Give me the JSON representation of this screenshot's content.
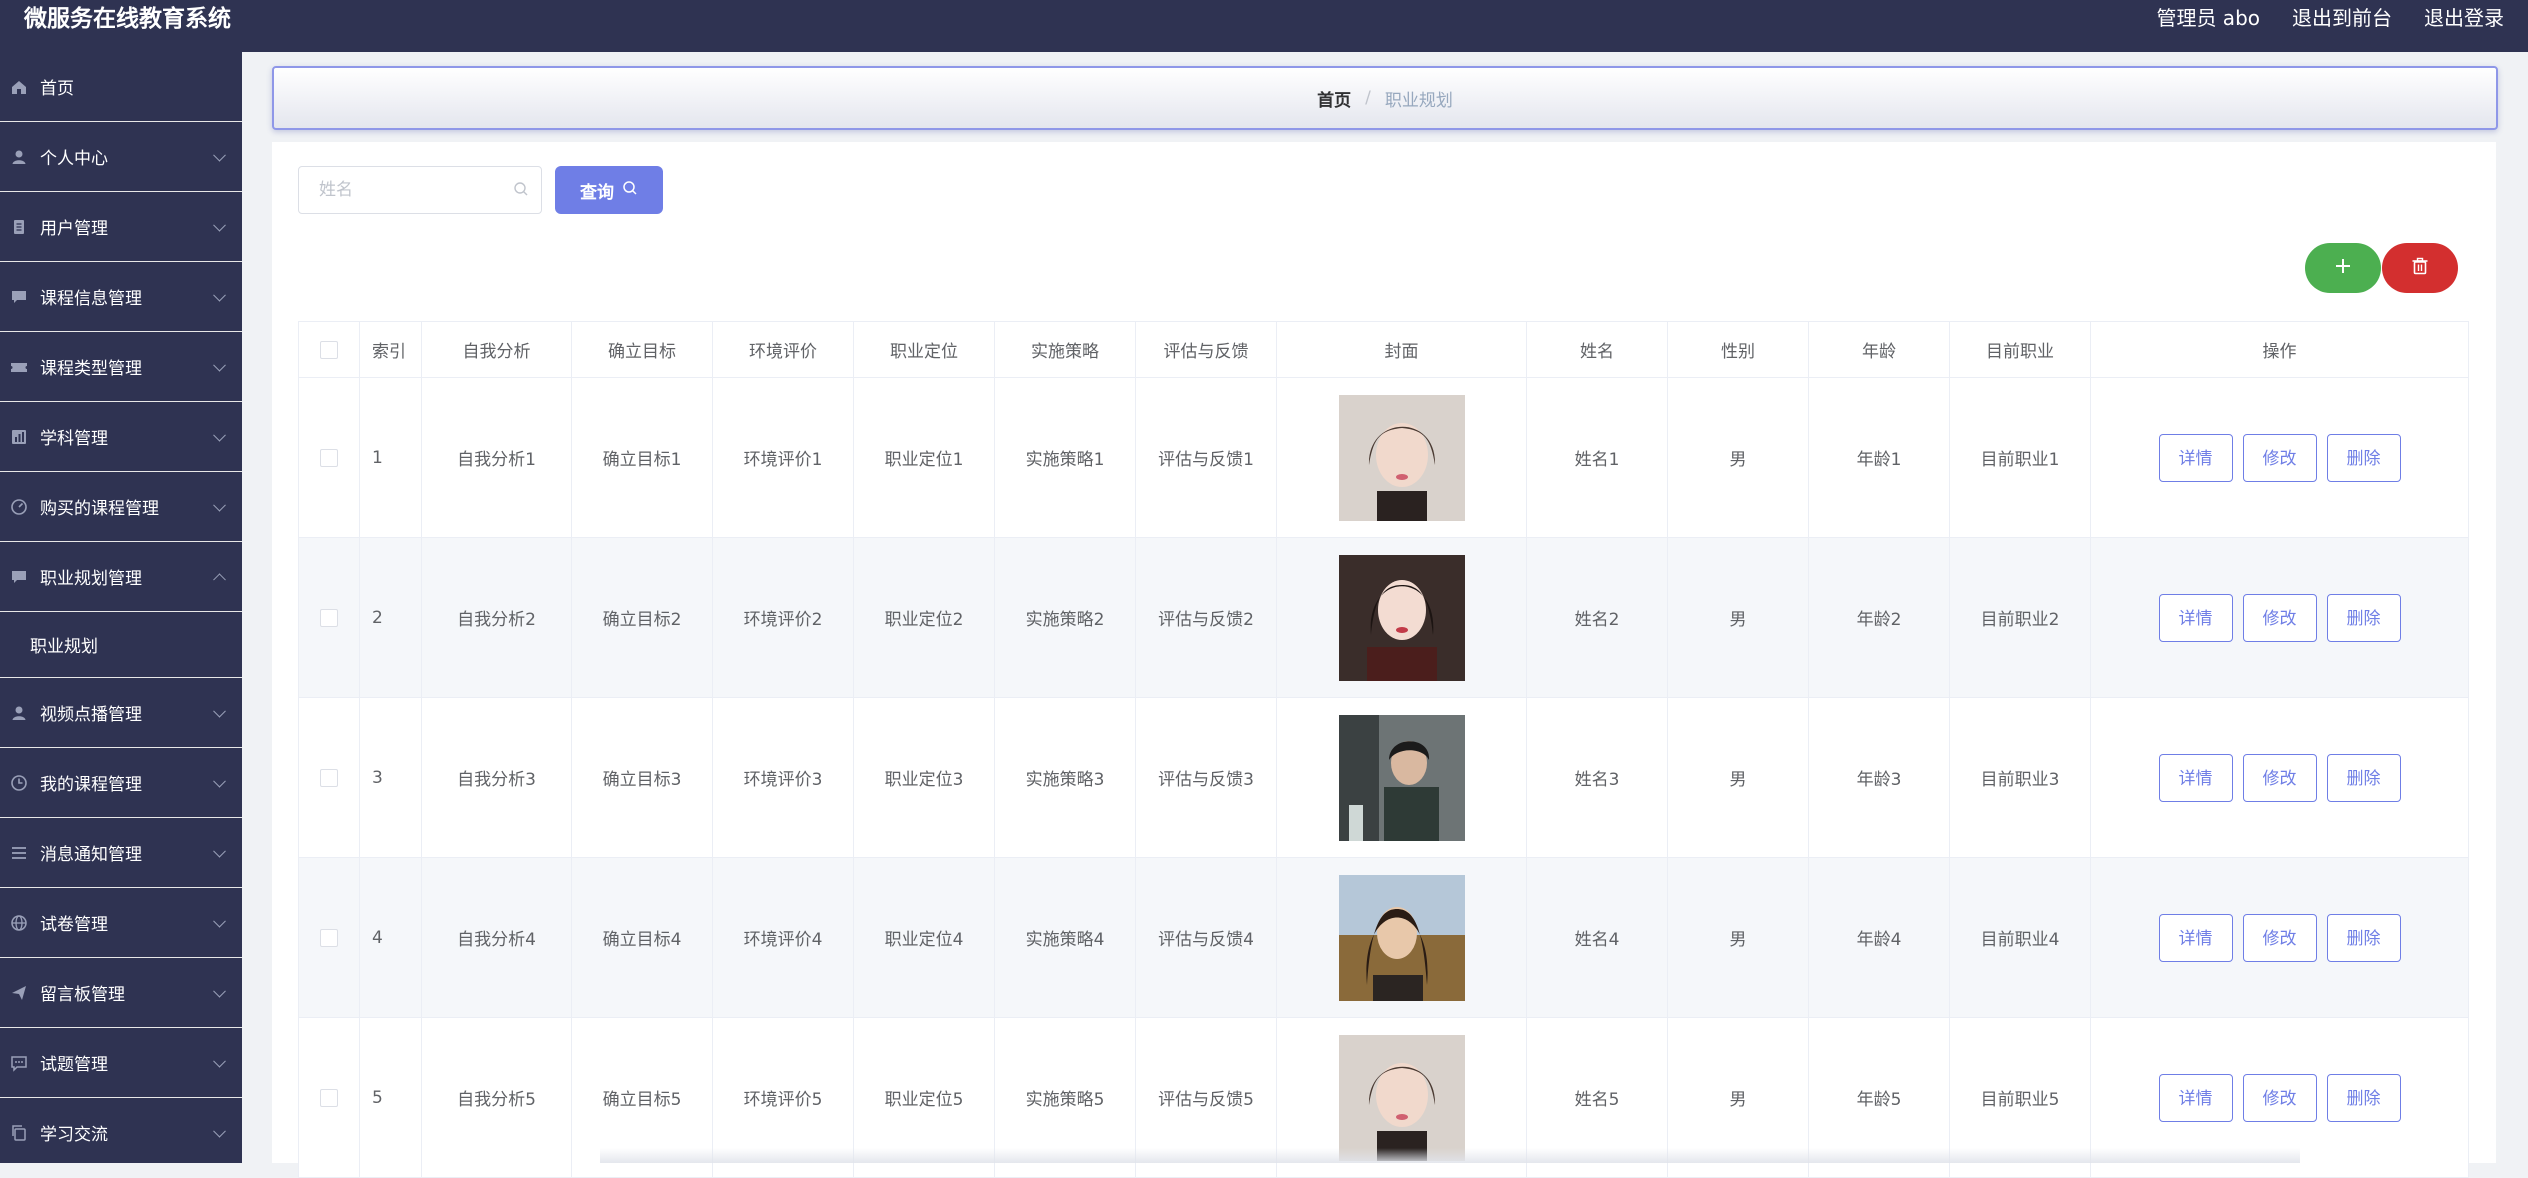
{
  "header": {
    "title": "微服务在线教育系统",
    "user_label": "管理员 abo",
    "front_link": "退出到前台",
    "logout_link": "退出登录"
  },
  "sidebar": {
    "items": [
      {
        "label": "首页",
        "icon": "home-icon",
        "expandable": false
      },
      {
        "label": "个人中心",
        "icon": "user-icon",
        "expandable": true
      },
      {
        "label": "用户管理",
        "icon": "document-icon",
        "expandable": true
      },
      {
        "label": "课程信息管理",
        "icon": "chat-icon",
        "expandable": true
      },
      {
        "label": "课程类型管理",
        "icon": "ticket-icon",
        "expandable": true
      },
      {
        "label": "学科管理",
        "icon": "chart-icon",
        "expandable": true
      },
      {
        "label": "购买的课程管理",
        "icon": "gauge-icon",
        "expandable": true
      },
      {
        "label": "职业规划管理",
        "icon": "chat-icon",
        "expandable": true,
        "expanded": true
      },
      {
        "label": "职业规划",
        "icon": "",
        "submenu": true
      },
      {
        "label": "视频点播管理",
        "icon": "user-icon",
        "expandable": true
      },
      {
        "label": "我的课程管理",
        "icon": "clock-icon",
        "expandable": true
      },
      {
        "label": "消息通知管理",
        "icon": "list-icon",
        "expandable": true
      },
      {
        "label": "试卷管理",
        "icon": "globe-icon",
        "expandable": true
      },
      {
        "label": "留言板管理",
        "icon": "send-icon",
        "expandable": true
      },
      {
        "label": "试题管理",
        "icon": "message-icon",
        "expandable": true
      },
      {
        "label": "学习交流",
        "icon": "copy-icon",
        "expandable": true
      }
    ]
  },
  "breadcrumb": {
    "home": "首页",
    "separator": "/",
    "current": "职业规划"
  },
  "search": {
    "placeholder": "姓名",
    "value": "",
    "button_label": "查询"
  },
  "table": {
    "columns": [
      "",
      "索引",
      "自我分析",
      "确立目标",
      "环境评价",
      "职业定位",
      "实施策略",
      "评估与反馈",
      "封面",
      "姓名",
      "性别",
      "年龄",
      "目前职业",
      "操作"
    ],
    "actions": {
      "detail": "详情",
      "edit": "修改",
      "delete": "删除"
    },
    "rows": [
      {
        "index": "1",
        "self_analysis": "自我分析1",
        "goal": "确立目标1",
        "environment": "环境评价1",
        "positioning": "职业定位1",
        "strategy": "实施策略1",
        "feedback": "评估与反馈1",
        "name": "姓名1",
        "gender": "男",
        "age": "年龄1",
        "occupation": "目前职业1"
      },
      {
        "index": "2",
        "self_analysis": "自我分析2",
        "goal": "确立目标2",
        "environment": "环境评价2",
        "positioning": "职业定位2",
        "strategy": "实施策略2",
        "feedback": "评估与反馈2",
        "name": "姓名2",
        "gender": "男",
        "age": "年龄2",
        "occupation": "目前职业2"
      },
      {
        "index": "3",
        "self_analysis": "自我分析3",
        "goal": "确立目标3",
        "environment": "环境评价3",
        "positioning": "职业定位3",
        "strategy": "实施策略3",
        "feedback": "评估与反馈3",
        "name": "姓名3",
        "gender": "男",
        "age": "年龄3",
        "occupation": "目前职业3"
      },
      {
        "index": "4",
        "self_analysis": "自我分析4",
        "goal": "确立目标4",
        "environment": "环境评价4",
        "positioning": "职业定位4",
        "strategy": "实施策略4",
        "feedback": "评估与反馈4",
        "name": "姓名4",
        "gender": "男",
        "age": "年龄4",
        "occupation": "目前职业4"
      },
      {
        "index": "5",
        "self_analysis": "自我分析5",
        "goal": "确立目标5",
        "environment": "环境评价5",
        "positioning": "职业定位5",
        "strategy": "实施策略5",
        "feedback": "评估与反馈5",
        "name": "姓名5",
        "gender": "男",
        "age": "年龄5",
        "occupation": "目前职业5"
      }
    ]
  },
  "colors": {
    "sidebar_bg": "#2f3352",
    "primary": "#6f7ee6",
    "add_button": "#4caf50",
    "delete_button": "#d32f2f"
  }
}
